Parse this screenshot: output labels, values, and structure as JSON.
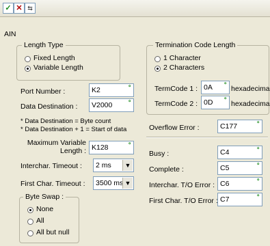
{
  "toolbar": {
    "check_icon": "check-icon",
    "close_icon": "x-close-icon",
    "flip_icon": "swap-icon"
  },
  "section_title": "AIN",
  "length_type": {
    "legend": "Length Type",
    "options": [
      {
        "label": "Fixed Length",
        "selected": false
      },
      {
        "label": "Variable Length",
        "selected": true
      }
    ]
  },
  "port_number": {
    "label": "Port Number :",
    "value": "K2"
  },
  "data_destination": {
    "label": "Data Destination :",
    "value": "V2000"
  },
  "notes": [
    "* Data Destination = Byte count",
    "* Data Destination + 1 = Start of data"
  ],
  "max_variable_length": {
    "label_line1": "Maximum Variable",
    "label_line2": "Length :",
    "value": "K128"
  },
  "interchar_timeout": {
    "label": "Interchar. Timeout :",
    "value": "2 ms"
  },
  "first_char_timeout": {
    "label": "First Char. Timeout :",
    "value": "3500 ms"
  },
  "byte_swap": {
    "legend": "Byte Swap :",
    "options": [
      {
        "label": "None",
        "selected": true
      },
      {
        "label": "All",
        "selected": false
      },
      {
        "label": "All but null",
        "selected": false
      }
    ]
  },
  "termination": {
    "legend": "Termination Code Length",
    "options": [
      {
        "label": "1 Character",
        "selected": false
      },
      {
        "label": "2 Characters",
        "selected": true
      }
    ],
    "termcode1": {
      "label": "TermCode 1 :",
      "value": "0A",
      "suffix": "hexadecimal"
    },
    "termcode2": {
      "label": "TermCode 2 :",
      "value": "0D",
      "suffix": "hexadecimal"
    }
  },
  "overflow_error": {
    "label": "Overflow Error :",
    "value": "C177"
  },
  "busy": {
    "label": "Busy :",
    "value": "C4"
  },
  "complete": {
    "label": "Complete :",
    "value": "C5"
  },
  "interchar_to_error": {
    "label": "Interchar. T/O Error :",
    "value": "C6"
  },
  "first_char_to_error": {
    "label": "First Char. T/O Error :",
    "value": "C7"
  }
}
